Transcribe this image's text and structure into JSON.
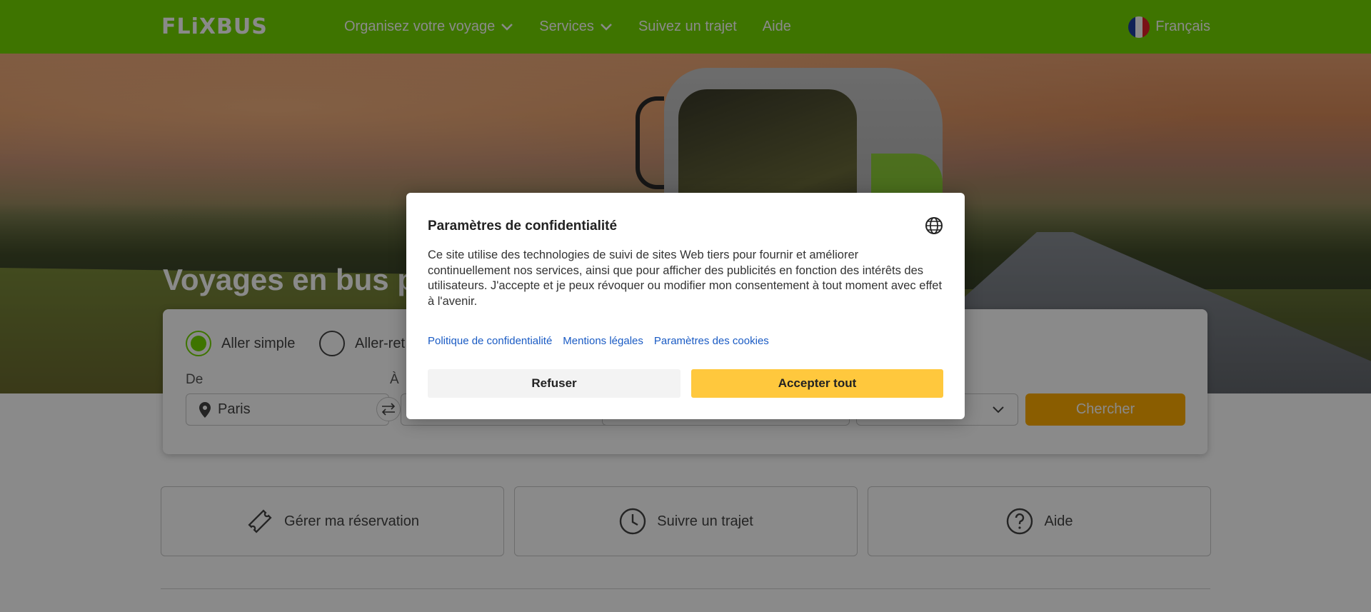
{
  "header": {
    "logo": "FLiXBUS",
    "nav": [
      {
        "label": "Organisez votre voyage",
        "has_dropdown": true
      },
      {
        "label": "Services",
        "has_dropdown": true
      },
      {
        "label": "Suivez un trajet",
        "has_dropdown": false
      },
      {
        "label": "Aide",
        "has_dropdown": false
      }
    ],
    "language": "Français"
  },
  "hero": {
    "title": "Voyages en bus pa"
  },
  "search": {
    "trip_types": [
      "Aller simple",
      "Aller-ret"
    ],
    "selected_trip_type": "Aller simple",
    "from_label": "De",
    "to_label": "À",
    "from_value": "Paris",
    "search_button": "Chercher"
  },
  "quick_links": [
    {
      "label": "Gérer ma réservation",
      "icon": "ticket-icon"
    },
    {
      "label": "Suivre un trajet",
      "icon": "clock-icon"
    },
    {
      "label": "Aide",
      "icon": "help-icon"
    }
  ],
  "modal": {
    "title": "Paramètres de confidentialité",
    "text": "Ce site utilise des technologies de suivi de sites Web tiers pour fournir et améliorer continuellement nos services, ainsi que pour afficher des publicités en fonction des intérêts des utilisateurs. J'accepte et je peux révoquer ou modifier mon consentement à tout moment avec effet à l'avenir.",
    "links": [
      "Politique de confidentialité",
      "Mentions légales",
      "Paramètres des cookies"
    ],
    "refuse": "Refuser",
    "accept": "Accepter tout"
  },
  "colors": {
    "brand_green": "#73d700",
    "accept_yellow": "#ffc83d",
    "search_button": "#ffad00",
    "link_blue": "#1a5bc4"
  }
}
